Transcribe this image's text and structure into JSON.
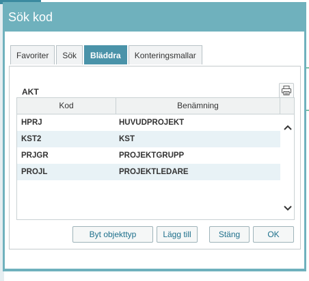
{
  "window": {
    "title": "Sök kod"
  },
  "tabs": [
    {
      "label": "Favoriter",
      "active": false
    },
    {
      "label": "Sök",
      "active": false
    },
    {
      "label": "Bläddra",
      "active": true
    },
    {
      "label": "Konteringsmallar",
      "active": false
    }
  ],
  "section": {
    "label": "AKT"
  },
  "grid": {
    "columns": [
      "Kod",
      "Benämning"
    ],
    "rows": [
      {
        "kod": "HPRJ",
        "benamning": "HUVUDPROJEKT"
      },
      {
        "kod": "KST2",
        "benamning": "KST"
      },
      {
        "kod": "PRJGR",
        "benamning": "PROJEKTGRUPP"
      },
      {
        "kod": "PROJL",
        "benamning": "PROJEKTLEDARE"
      }
    ]
  },
  "buttons": {
    "change_type": "Byt objekttyp",
    "add": "Lägg till",
    "close": "Stäng",
    "ok": "OK"
  },
  "icons": {
    "print": "printer-icon",
    "scroll_up": "chevron-up-icon",
    "scroll_down": "chevron-down-icon"
  },
  "colors": {
    "title_bar": "#6fb1bd",
    "active_tab": "#4a93a9",
    "alt_row": "#e8f2f6",
    "button_text": "#1d6f8b"
  }
}
